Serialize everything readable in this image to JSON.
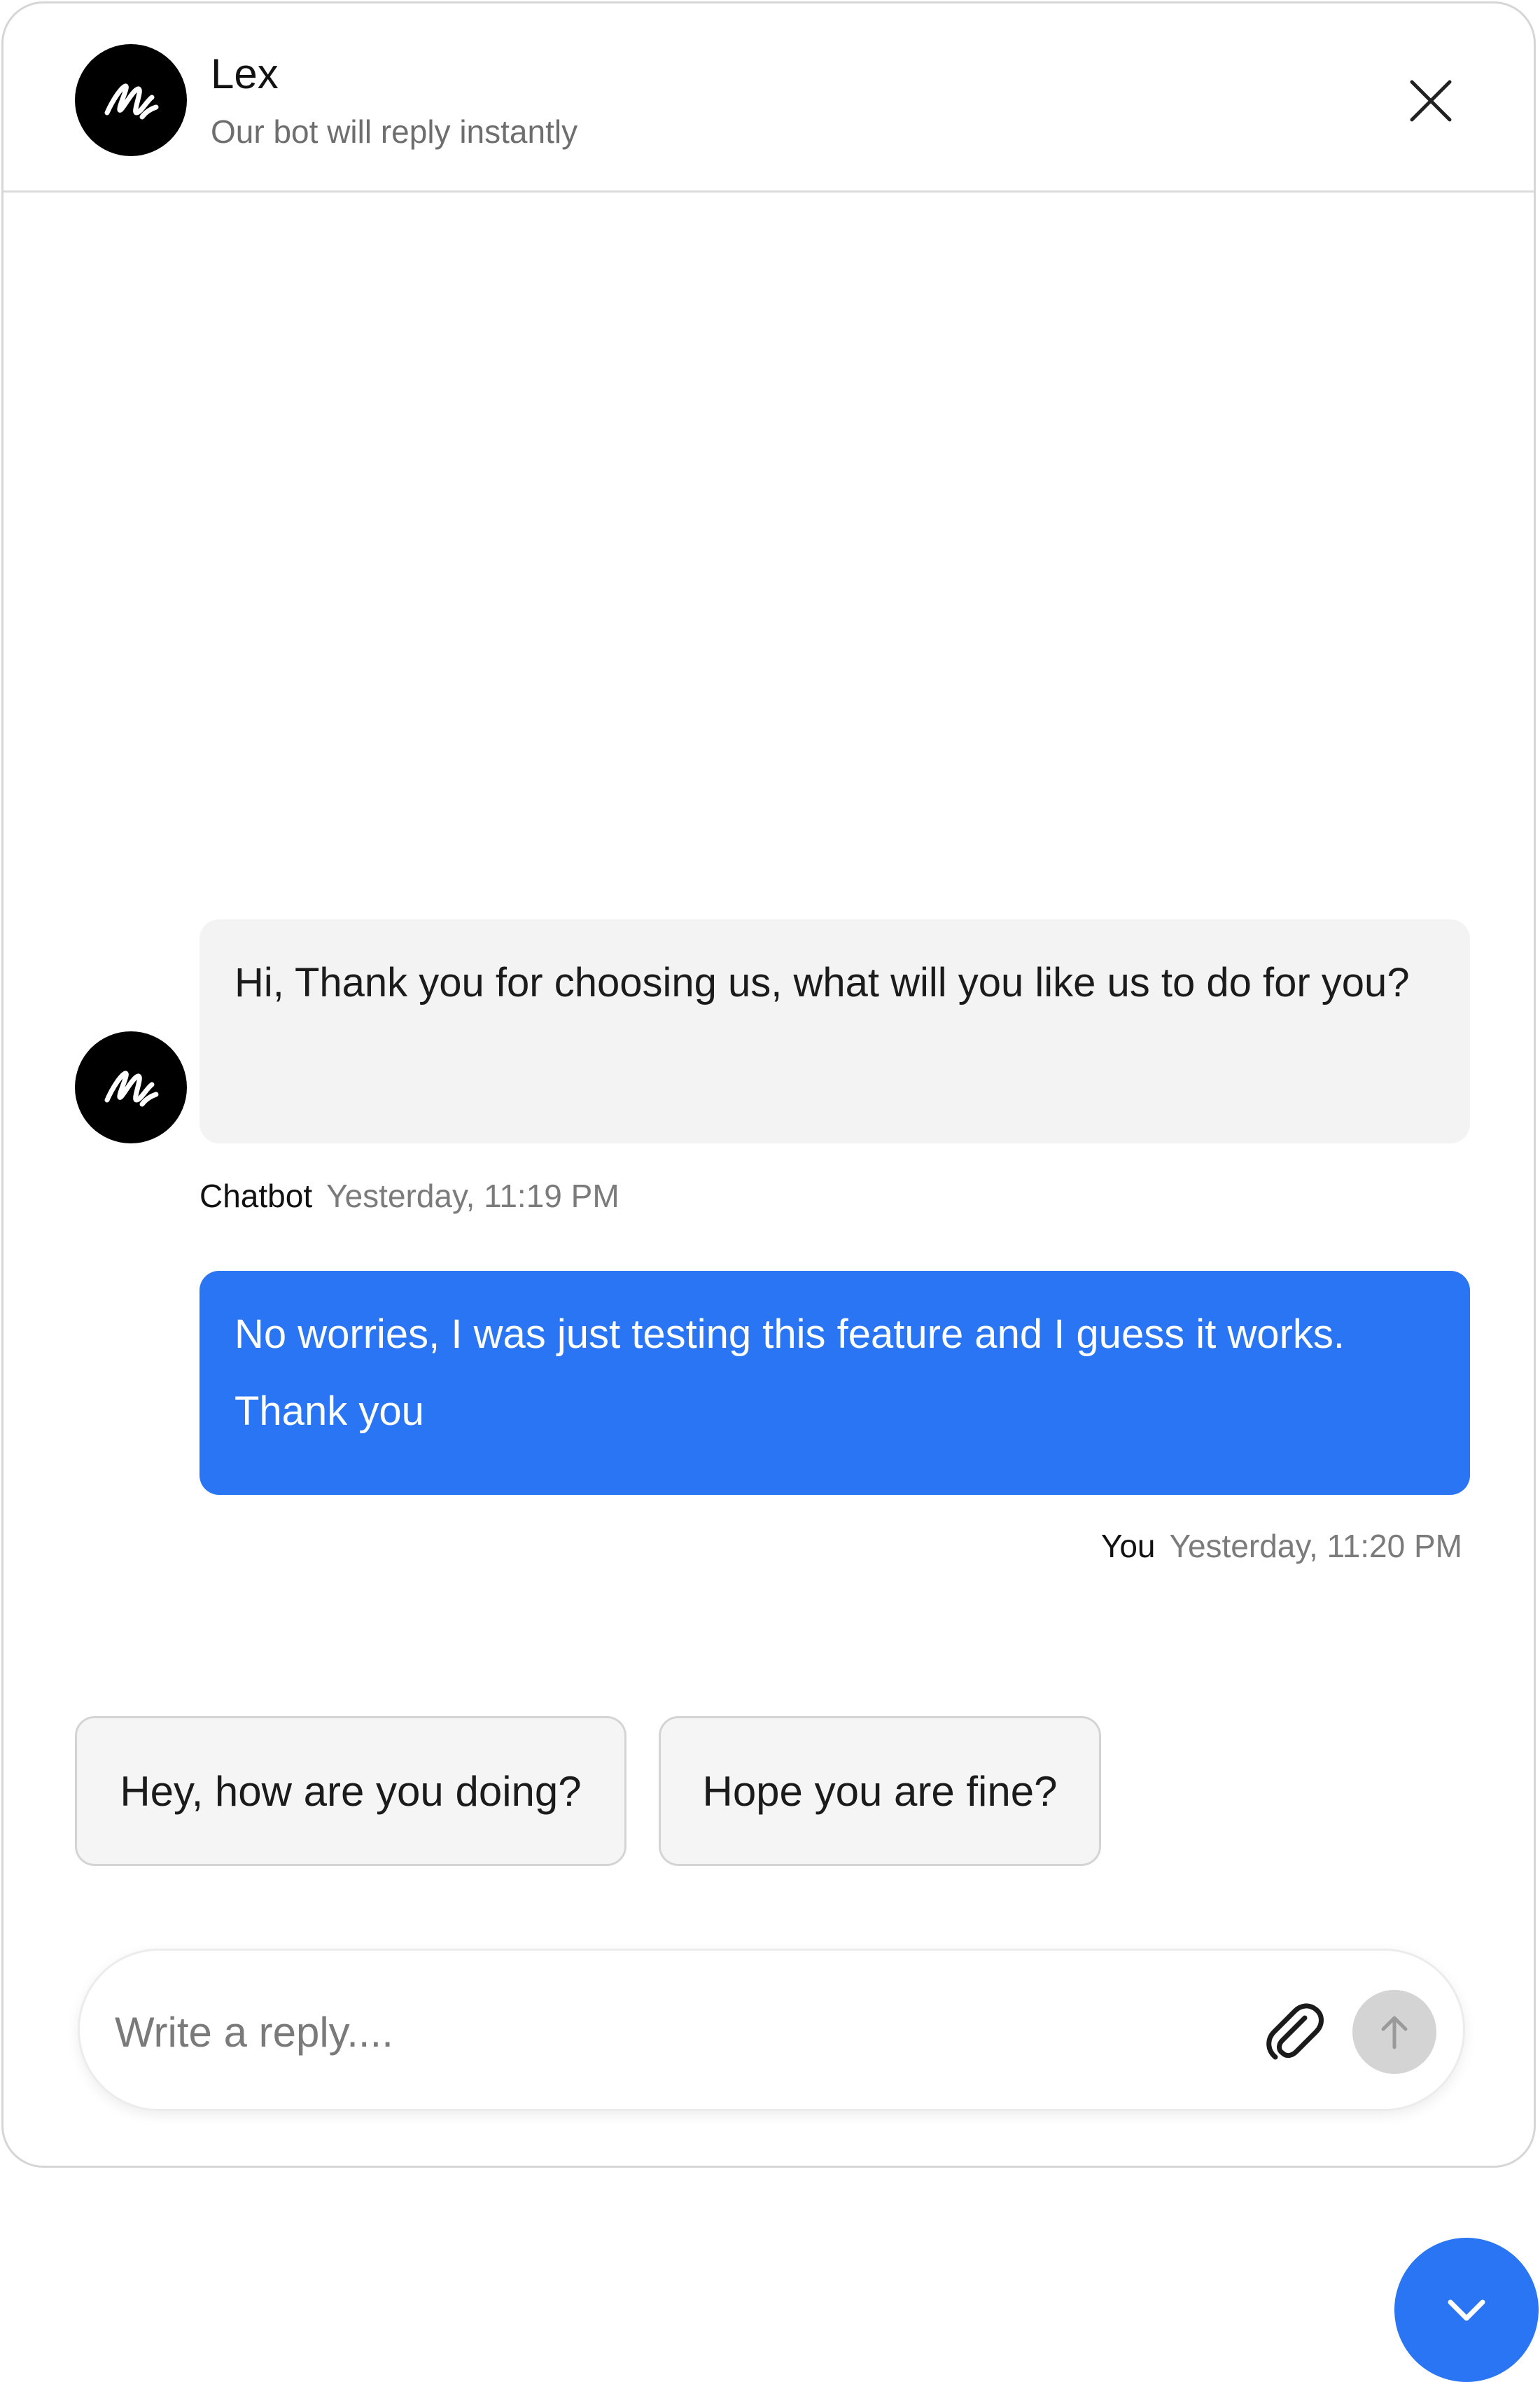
{
  "header": {
    "name": "Lex",
    "subtitle": "Our bot will reply instantly",
    "close_icon": "close-icon",
    "avatar_icon": "signature-logo-icon"
  },
  "messages": [
    {
      "sender": "Chatbot",
      "time": "Yesterday, 11:19 PM",
      "text": "Hi, Thank you for choosing us, what will you like us to do for you?"
    },
    {
      "sender": "You",
      "time": "Yesterday, 11:20 PM",
      "text": "No worries, I was just testing this feature and I guess it works. Thank you"
    }
  ],
  "quick_replies": [
    "Hey, how are you doing?",
    "Hope you are fine?"
  ],
  "composer": {
    "placeholder": "Write a reply....",
    "attach_icon": "paperclip-icon",
    "send_icon": "arrow-up-icon"
  },
  "fab_icon": "chevron-down-icon",
  "colors": {
    "accent": "#2a75f3",
    "bot_bubble": "#f3f3f3",
    "send_disabled": "#d4d4d4"
  }
}
